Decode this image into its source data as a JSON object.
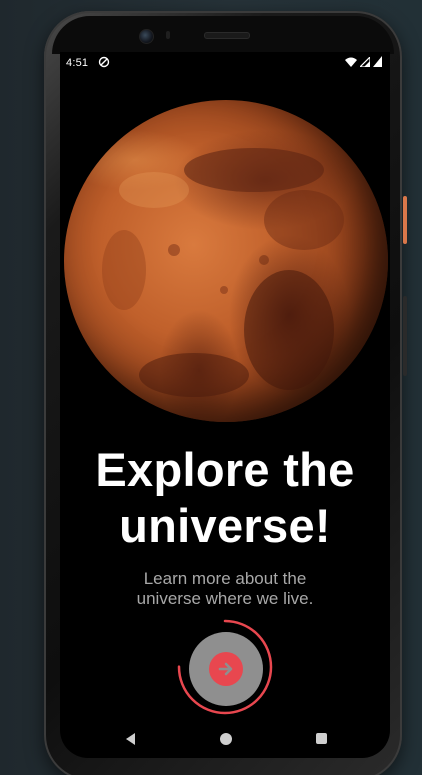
{
  "status_bar": {
    "time": "4:51",
    "left_icons": [
      "sync-icon"
    ],
    "right_icons": [
      "wifi-icon",
      "cell-signal-icon",
      "battery-icon"
    ]
  },
  "hero": {
    "image": "mars-planet",
    "title_line1": "Explore the",
    "title_line2": "universe!",
    "subtitle_line1": "Learn more about the",
    "subtitle_line2": "universe where we live."
  },
  "cta": {
    "icon": "arrow-right-icon",
    "progress": 0.75
  },
  "nav_bar": {
    "icons": [
      "back-icon",
      "home-icon",
      "recents-icon"
    ]
  },
  "colors": {
    "background": "#000000",
    "title": "#ffffff",
    "subtitle": "#a8a8a8",
    "accent": "#e8474f",
    "cta_fill": "#8f8f8f"
  }
}
